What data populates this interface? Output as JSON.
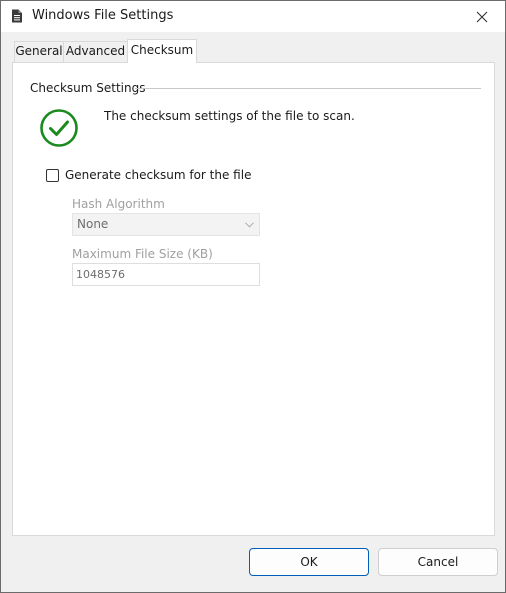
{
  "window": {
    "title": "Windows File Settings",
    "icon": "document-icon",
    "close_icon": "close-icon"
  },
  "tabs": [
    {
      "label": "General",
      "active": false
    },
    {
      "label": "Advanced",
      "active": false
    },
    {
      "label": "Checksum",
      "active": true
    }
  ],
  "panel": {
    "group_title": "Checksum Settings",
    "status_icon": "checkmark-circle-icon",
    "description": "The checksum settings of the file to scan.",
    "generate_checkbox": {
      "label": "Generate checksum for the file",
      "checked": false
    },
    "hash_algorithm": {
      "label": "Hash Algorithm",
      "value": "None",
      "enabled": false
    },
    "max_file_size": {
      "label": "Maximum File Size (KB)",
      "value": "1048576",
      "enabled": false
    }
  },
  "buttons": {
    "ok": "OK",
    "cancel": "Cancel"
  },
  "colors": {
    "accent": "#005fb8",
    "success": "#1a8a1e",
    "disabled_text": "#a0a0a0"
  }
}
